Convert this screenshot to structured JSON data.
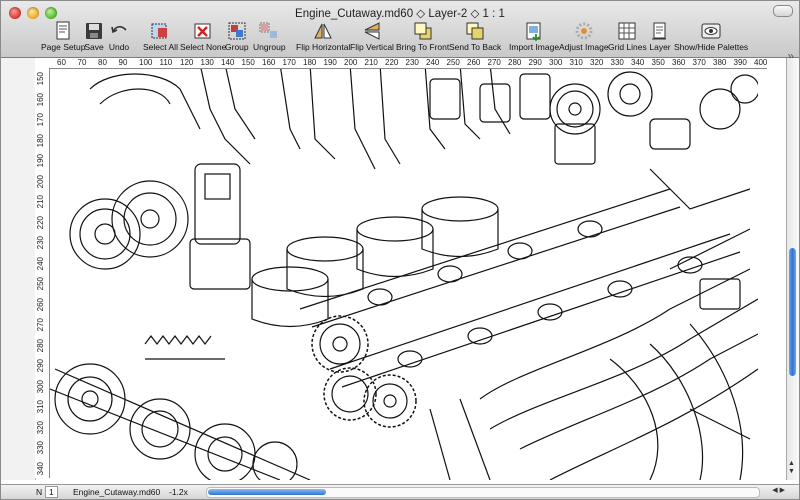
{
  "window": {
    "title": "Engine_Cutaway.md60  ◇ Layer-2 ◇ 1 : 1"
  },
  "toolbar": {
    "items": [
      {
        "id": "page-setup",
        "label": "Page Setup",
        "icon": "page-setup-icon"
      },
      {
        "id": "save",
        "label": "Save",
        "icon": "save-icon"
      },
      {
        "id": "undo",
        "label": "Undo",
        "icon": "undo-icon"
      },
      {
        "id": "select-all",
        "label": "Select All",
        "icon": "select-all-icon"
      },
      {
        "id": "select-none",
        "label": "Select None",
        "icon": "select-none-icon"
      },
      {
        "id": "group",
        "label": "Group",
        "icon": "group-icon"
      },
      {
        "id": "ungroup",
        "label": "Ungroup",
        "icon": "ungroup-icon"
      },
      {
        "id": "flip-horizontal",
        "label": "Flip Horizontal",
        "icon": "flip-horizontal-icon"
      },
      {
        "id": "flip-vertical",
        "label": "Flip Vertical",
        "icon": "flip-vertical-icon"
      },
      {
        "id": "bring-to-front",
        "label": "Bring To Front",
        "icon": "bring-to-front-icon"
      },
      {
        "id": "send-to-back",
        "label": "Send To Back",
        "icon": "send-to-back-icon"
      },
      {
        "id": "import-image",
        "label": "Import Image",
        "icon": "import-image-icon"
      },
      {
        "id": "adjust-image",
        "label": "Adjust Image",
        "icon": "adjust-image-icon"
      },
      {
        "id": "grid-lines",
        "label": "Grid Lines",
        "icon": "grid-lines-icon"
      },
      {
        "id": "layer",
        "label": "Layer",
        "icon": "layer-icon"
      },
      {
        "id": "show-hide-palettes",
        "label": "Show/Hide Palettes",
        "icon": "palettes-icon"
      }
    ],
    "overflow_glyph": "»"
  },
  "ruler": {
    "top": [
      "60",
      "70",
      "80",
      "90",
      "100",
      "110",
      "120",
      "130",
      "140",
      "150",
      "160",
      "170",
      "180",
      "190",
      "200",
      "210",
      "220",
      "230",
      "240",
      "250",
      "260",
      "270",
      "280",
      "290",
      "300",
      "310",
      "320",
      "330",
      "340",
      "350",
      "360",
      "370",
      "380",
      "390",
      "400"
    ],
    "left": [
      "150",
      "160",
      "170",
      "180",
      "190",
      "200",
      "210",
      "220",
      "230",
      "240",
      "250",
      "260",
      "270",
      "280",
      "290",
      "300",
      "310",
      "320",
      "330",
      "340"
    ]
  },
  "statusbar": {
    "arrow_label": "N",
    "page_value": "1",
    "filename": "Engine_Cutaway.md60",
    "zoom": "-1.2x"
  },
  "colors": {
    "accent": "#2e74d2",
    "close": "#e0443e",
    "minimize": "#f2b531",
    "zoom": "#5fc43b"
  }
}
